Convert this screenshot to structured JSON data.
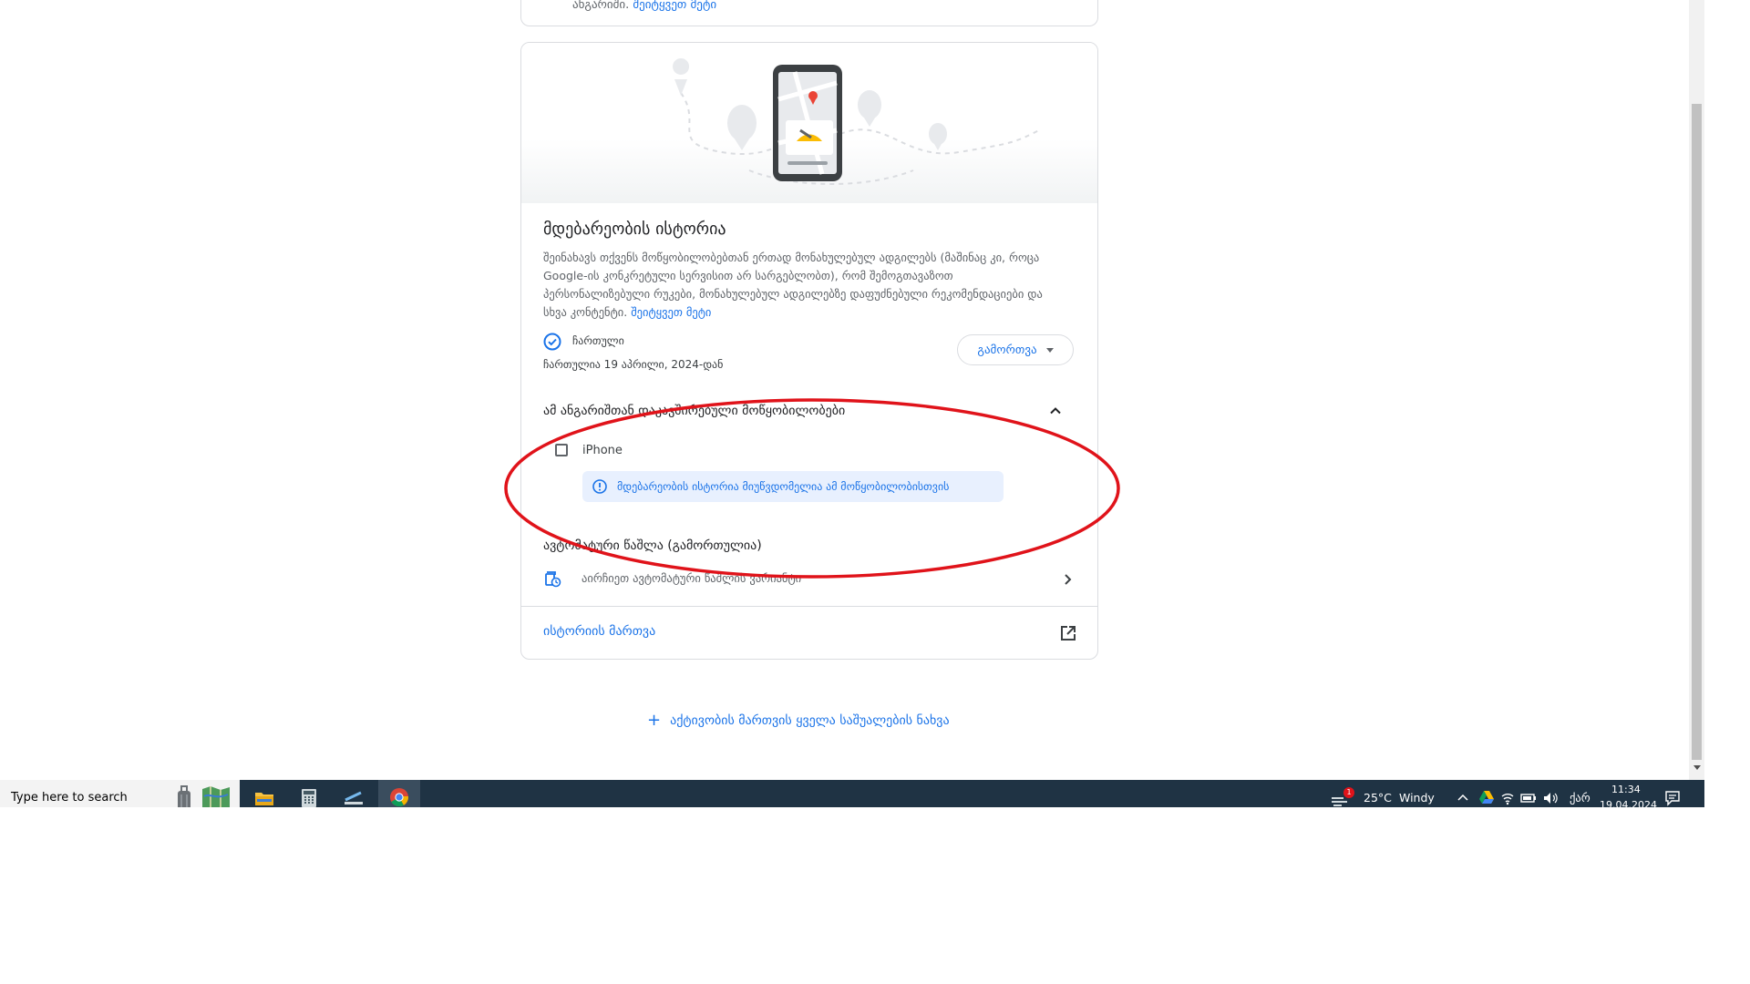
{
  "previous_card": {
    "text": "ანგარიში.",
    "link": "შეიტყვეთ მეტი"
  },
  "location_history": {
    "title": "მდებარეობის ისტორია",
    "description": "შეინახავს თქვენს მოწყობილობებთან ერთად მონახულებულ ადგილებს (მაშინაც კი, როცა Google-ის კონკრეტული სერვისით არ სარგებლობთ), რომ შემოგთავაზოთ პერსონალიზებული რუკები, მონახულებულ ადგილებზე დაფუძნებული რეკომენდაციები და სხვა კონტენტი.",
    "learn_more": "შეიტყვეთ მეტი",
    "status_label": "ჩართული",
    "status_since": "ჩართულია 19 აპრილი, 2024-დან",
    "toggle_button": "გამორთვა",
    "devices_section_title": "ამ ანგარიშთან დაკავშირებული მოწყობილობები",
    "device_name": "iPhone",
    "device_notice": "მდებარეობის ისტორია მიუწვდომელია ამ მოწყობილობისთვის",
    "auto_delete_title": "ავტომატური წაშლა (გამორთულია)",
    "auto_delete_desc": "აირჩიეთ ავტომატური წაშლის ვარიანტი",
    "manage_history": "ისტორიის მართვა"
  },
  "all_controls_link": "აქტივობის მართვის ყველა საშუალების ნახვა",
  "taskbar": {
    "search_placeholder": "Type here to search",
    "weather_temp": "25°C",
    "weather_desc": "Windy",
    "weather_badge": "1",
    "language": "ქარ",
    "time": "11:34",
    "date": "19.04.2024"
  },
  "colors": {
    "link": "#1a73e8",
    "annotation": "#e0131a",
    "taskbar": "#1f3344"
  }
}
